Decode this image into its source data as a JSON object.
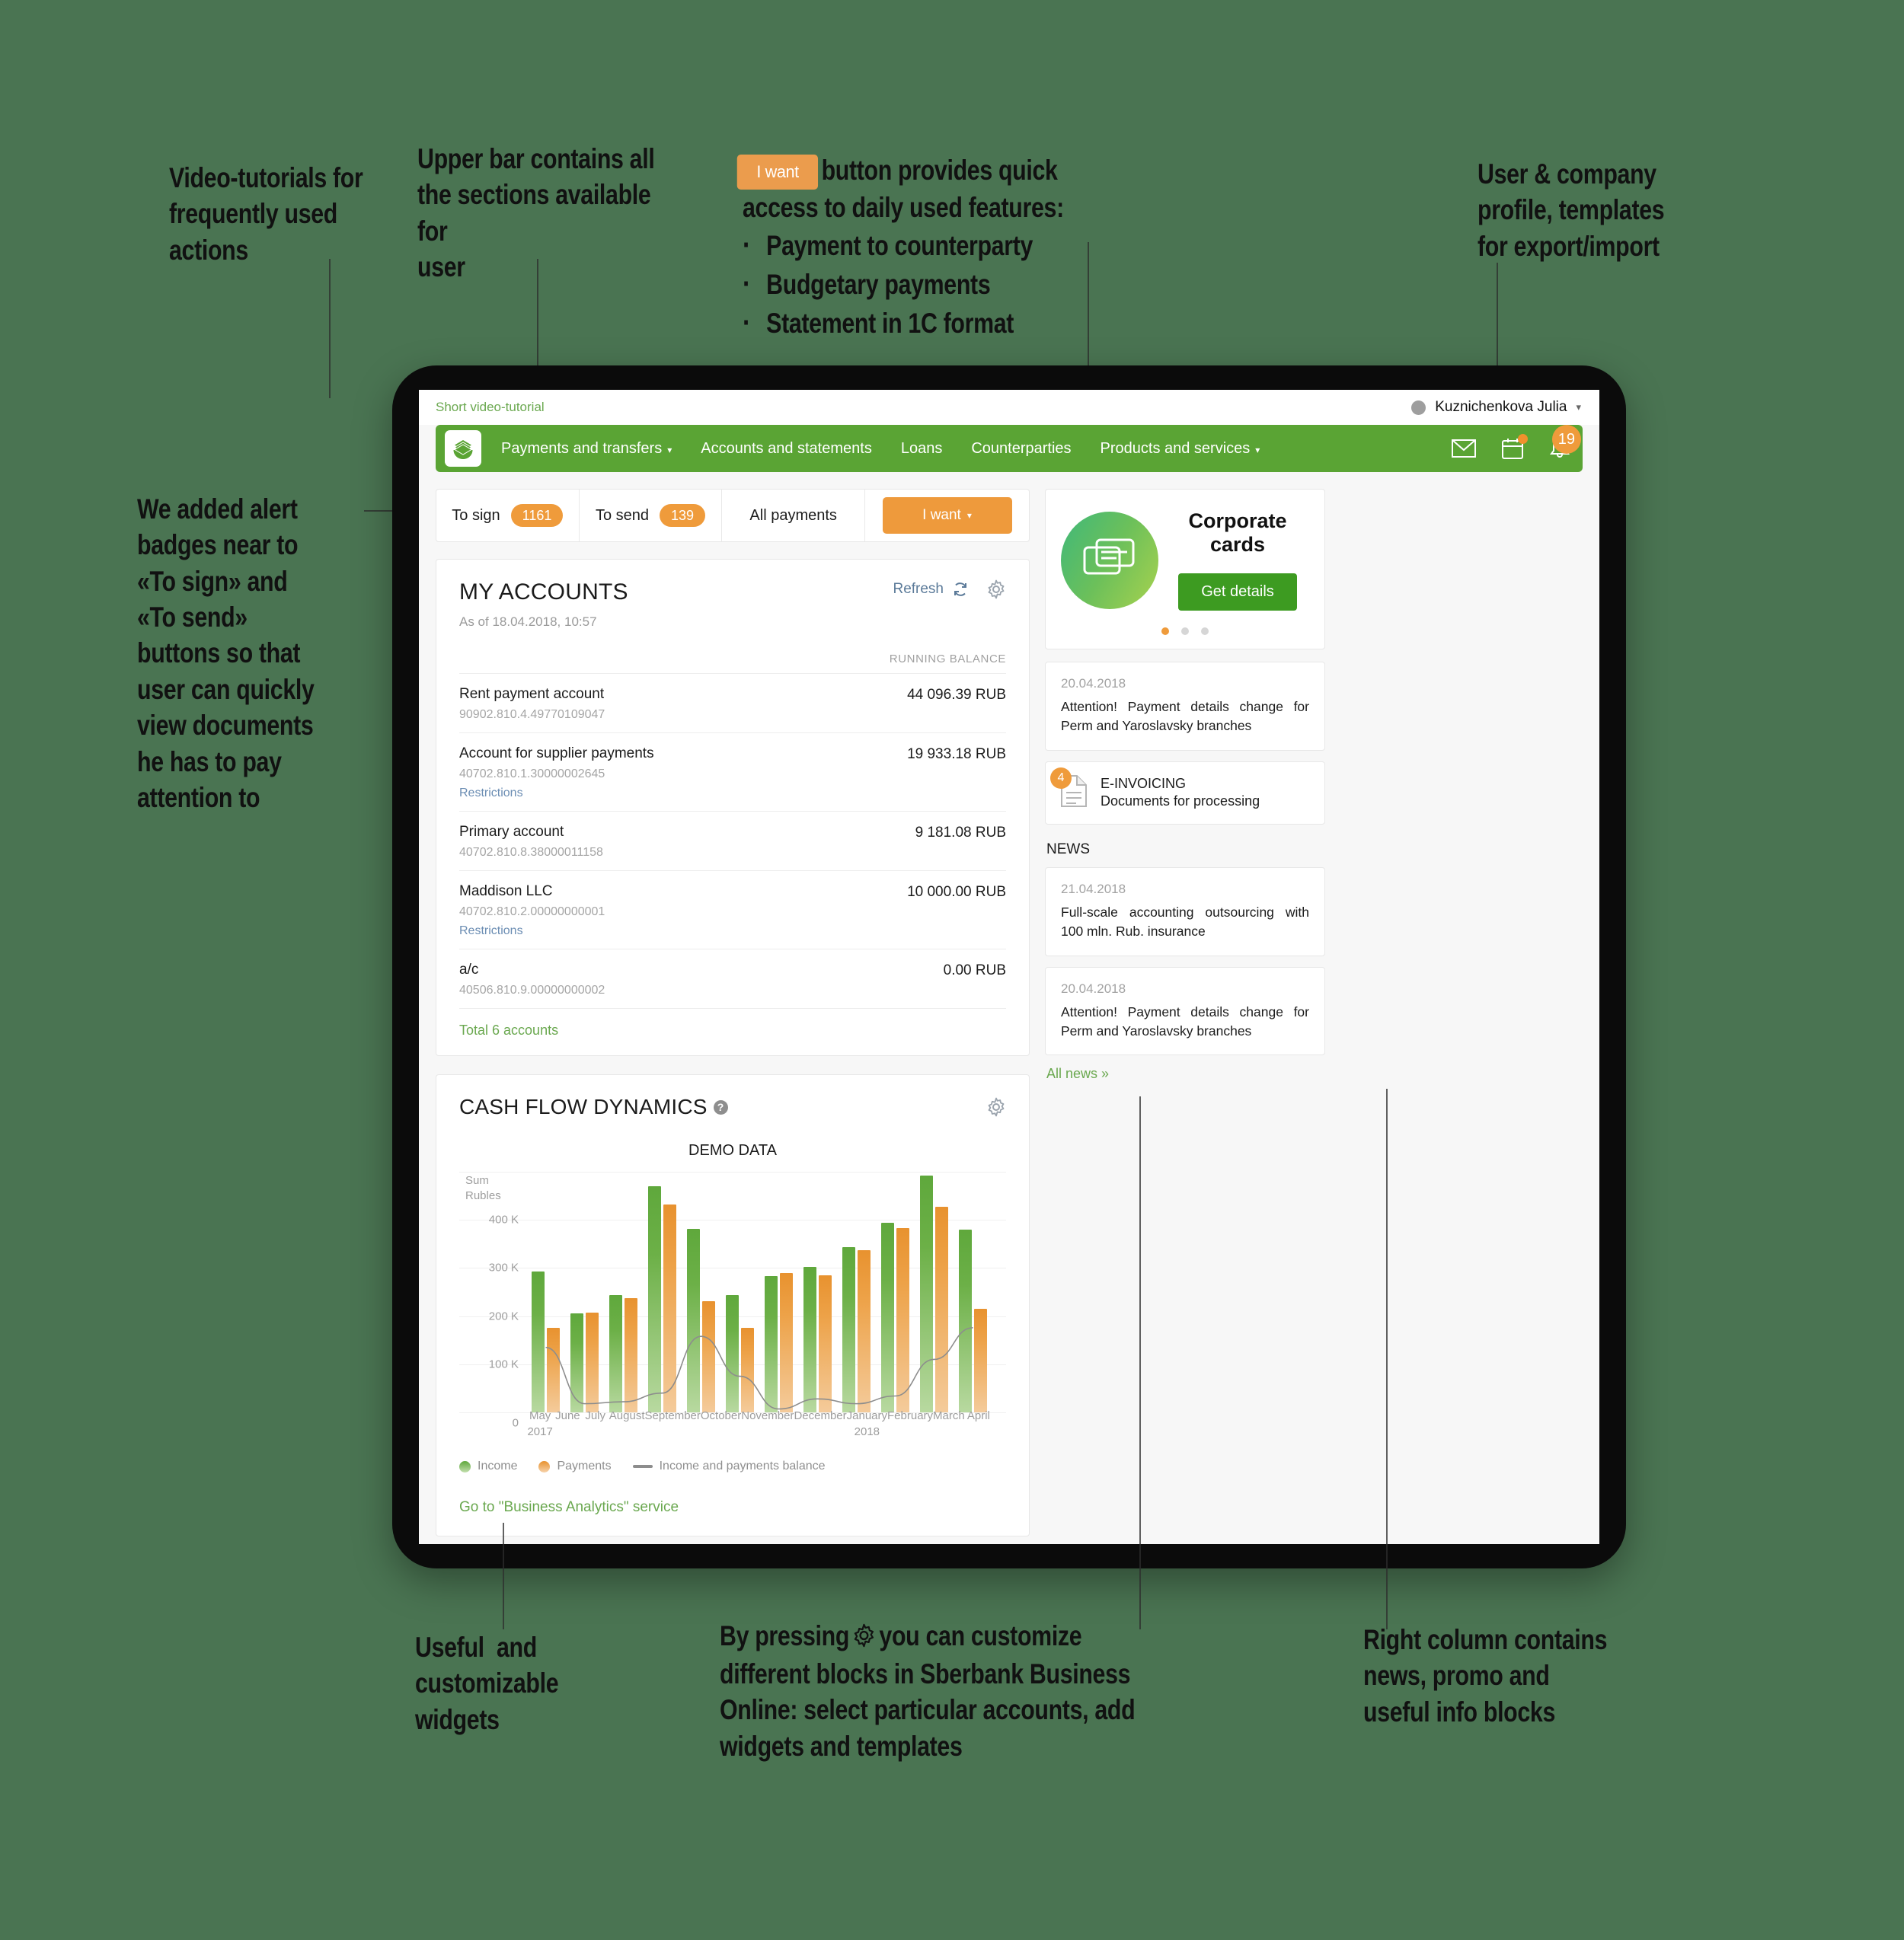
{
  "annotations": {
    "a1": "Video-tutorials for\nfrequently used\nactions",
    "a2": "Upper bar contains all\nthe sections available for\nuser",
    "a3_btn": "I want",
    "a3_after": "button provides quick",
    "a3_line2": "access to daily used features:",
    "a3_bullets": [
      "Payment to counterparty",
      "Budgetary payments",
      "Statement in 1C format"
    ],
    "a4": "User & company\nprofile, templates\nfor export/import",
    "a5": "We added alert\nbadges near to\n«To sign» and\n«To send»\nbuttons so that\nuser can quickly\nview documents\nhe has to pay\nattention to",
    "a6": "Useful  and\ncustomizable\nwidgets",
    "a7_before": "By pressing",
    "a7_after": "you can customize\ndifferent blocks in Sberbank Business\nOnline: select particular accounts, add\nwidgets and templates",
    "a8": "Right column contains\nnews, promo and\nuseful info blocks"
  },
  "utilbar": {
    "video_tutorial": "Short video-tutorial",
    "user_name": "Kuznichenkova Julia",
    "caret": "▾"
  },
  "nav": {
    "logo": "sberbank-logo",
    "items": [
      {
        "label": "Payments and transfers",
        "caret": "▾"
      },
      {
        "label": "Accounts and statements",
        "caret": ""
      },
      {
        "label": "Loans",
        "caret": ""
      },
      {
        "label": "Counterparties",
        "caret": ""
      },
      {
        "label": "Products and services",
        "caret": "▾"
      }
    ],
    "notifications_count": "19"
  },
  "quickbar": {
    "to_sign_label": "To sign",
    "to_sign_count": "1161",
    "to_send_label": "To send",
    "to_send_count": "139",
    "all_payments_label": "All payments",
    "i_want_label": "I want",
    "i_want_caret": "▾"
  },
  "accounts": {
    "title": "MY ACCOUNTS",
    "refresh_label": "Refresh",
    "as_of": "As of 18.04.2018, 10:57",
    "running_balance_header": "RUNNING BALANCE",
    "rows": [
      {
        "name": "Rent payment account",
        "number": "90902.810.4.49770109047",
        "restrictions": "",
        "balance": "44 096.39 RUB"
      },
      {
        "name": "Account for supplier payments",
        "number": "40702.810.1.30000002645",
        "restrictions": "Restrictions",
        "balance": "19 933.18 RUB"
      },
      {
        "name": "Primary account",
        "number": "40702.810.8.38000011158",
        "restrictions": "",
        "balance": "9 181.08 RUB"
      },
      {
        "name": "Maddison LLC",
        "number": "40702.810.2.00000000001",
        "restrictions": "Restrictions",
        "balance": "10 000.00 RUB"
      },
      {
        "name": "a/c",
        "number": "40506.810.9.00000000002",
        "restrictions": "",
        "balance": "0.00 RUB"
      }
    ],
    "total": "Total 6 accounts"
  },
  "cashflow": {
    "title": "CASH FLOW DYNAMICS",
    "help": "?",
    "link": "Go to \"Business Analytics\" service"
  },
  "chart_data": {
    "type": "bar",
    "title": "DEMO DATA",
    "ylabel": "Sum\nRubles",
    "xlabel": "",
    "categories": [
      "May",
      "June",
      "July",
      "August",
      "September",
      "October",
      "November",
      "December",
      "January",
      "February",
      "March",
      "April"
    ],
    "category_sub": [
      "2017",
      "",
      "",
      "",
      "",
      "",
      "",
      "",
      "2018",
      "",
      "",
      ""
    ],
    "yticks": [
      0,
      100000,
      200000,
      300000,
      400000
    ],
    "ytick_labels": [
      "0",
      "100 K",
      "200 K",
      "300 K",
      "400 K"
    ],
    "ylim": [
      0,
      500000
    ],
    "grid": true,
    "legend_position": "bottom",
    "series": [
      {
        "name": "Income",
        "color": "#5fa83c",
        "values": [
          292000,
          205000,
          244000,
          470000,
          382000,
          243000,
          283000,
          303000,
          344000,
          394000,
          492000,
          379000
        ]
      },
      {
        "name": "Payments",
        "color": "#e8922f",
        "values": [
          175000,
          207000,
          238000,
          432000,
          231000,
          176000,
          290000,
          285000,
          337000,
          383000,
          427000,
          215000
        ]
      },
      {
        "name": "Income and payments balance",
        "type": "line",
        "color": "#8d8d8d",
        "values": [
          135000,
          18000,
          22000,
          40000,
          158000,
          75000,
          7000,
          28000,
          18000,
          34000,
          110000,
          176000
        ]
      }
    ]
  },
  "promo": {
    "title": "Corporate cards",
    "cta": "Get details",
    "dots": 3,
    "active_dot": 0
  },
  "alert": {
    "date": "20.04.2018",
    "text": "Attention! Payment details change for Perm and Yaroslavsky branches"
  },
  "einvoicing": {
    "badge": "4",
    "title": "E-INVOICING",
    "subtitle": "Documents for processing"
  },
  "news": {
    "header": "NEWS",
    "items": [
      {
        "date": "21.04.2018",
        "text": "Full-scale accounting outsourcing with 100 mln. Rub. insurance"
      },
      {
        "date": "20.04.2018",
        "text": "Attention! Payment details change for Perm and Yaroslavsky branches"
      }
    ],
    "all_news": "All news »"
  },
  "colors": {
    "background": "#4a7452",
    "brand_green": "#5aa434",
    "accent_orange": "#ef9b3b",
    "link_green": "#6aa84f",
    "button_green": "#3d9b21"
  }
}
